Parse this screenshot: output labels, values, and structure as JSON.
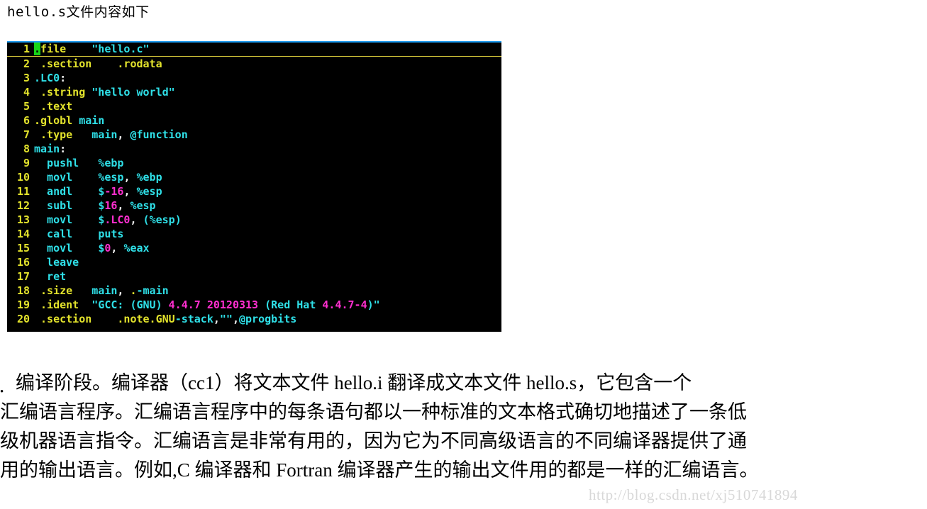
{
  "heading": "hello.s文件内容如下",
  "editor": {
    "background": "#000000",
    "top_rule_color": "#1d9bf0",
    "cursorline_rule_color": "#d8c93a",
    "cursor_color": "#17d417",
    "linenumber_color": "#e3e32c",
    "colors": {
      "directive": "#e3e32c",
      "identifier": "#2fe0e8",
      "string": "#2fe0e8",
      "number": "#ff2fd0"
    },
    "lines": [
      {
        "n": "1",
        "text": ".file\t\"hello.c\""
      },
      {
        "n": "2",
        "text": ".section\t.rodata"
      },
      {
        "n": "3",
        "text": ".LC0:"
      },
      {
        "n": "4",
        "text": ".string \"hello world\""
      },
      {
        "n": "5",
        "text": ".text"
      },
      {
        "n": "6",
        "text": ".globl main"
      },
      {
        "n": "7",
        "text": ".type\tmain, @function"
      },
      {
        "n": "8",
        "text": "main:"
      },
      {
        "n": "9",
        "text": "pushl\t%ebp"
      },
      {
        "n": "10",
        "text": "movl\t%esp, %ebp"
      },
      {
        "n": "11",
        "text": "andl\t$-16, %esp"
      },
      {
        "n": "12",
        "text": "subl\t$16, %esp"
      },
      {
        "n": "13",
        "text": "movl\t$.LC0, (%esp)"
      },
      {
        "n": "14",
        "text": "call\tputs"
      },
      {
        "n": "15",
        "text": "movl\t$0, %eax"
      },
      {
        "n": "16",
        "text": "leave"
      },
      {
        "n": "17",
        "text": "ret"
      },
      {
        "n": "18",
        "text": ".size\tmain, .-main"
      },
      {
        "n": "19",
        "text": ".ident\t\"GCC: (GNU) 4.4.7 20120313 (Red Hat 4.4.7-4)\""
      },
      {
        "n": "20",
        "text": ".section\t.note.GNU-stack,\"\",@progbits"
      }
    ]
  },
  "paragraph": {
    "bullet": "•",
    "lines": [
      "编译阶段。编译器（cc1）将文本文件 hello.i 翻译成文本文件 hello.s，它包含一个",
      "汇编语言程序。汇编语言程序中的每条语句都以一种标准的文本格式确切地描述了一条低",
      "级机器语言指令。汇编语言是非常有用的，因为它为不同高级语言的不同编译器提供了通",
      "用的输出语言。例如,C 编译器和 Fortran 编译器产生的输出文件用的都是一样的汇编语言。"
    ]
  },
  "watermark": "http://blog.csdn.net/xj510741894"
}
